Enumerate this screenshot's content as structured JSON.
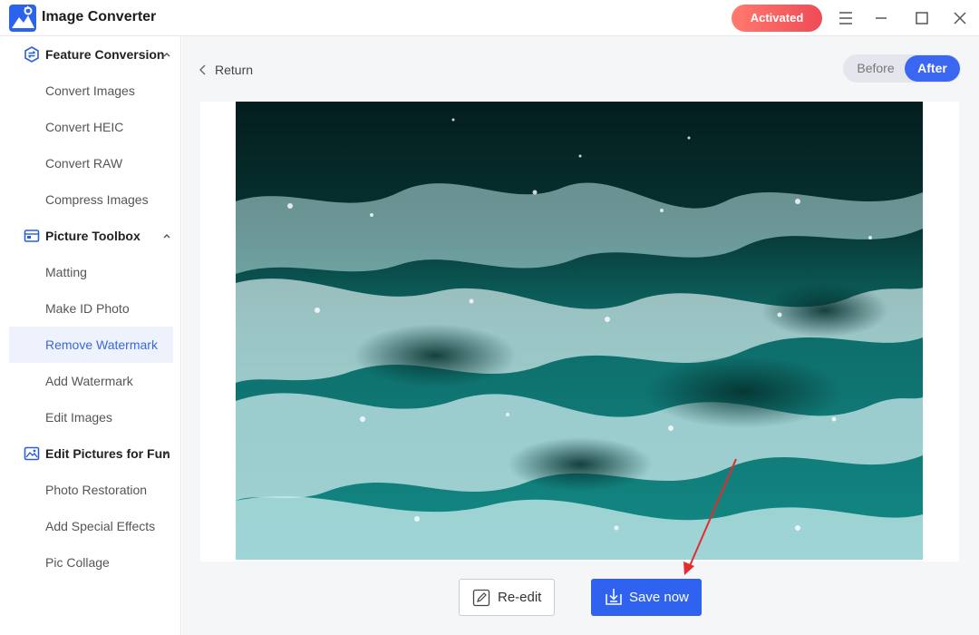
{
  "app": {
    "title": "Image Converter",
    "status_button": "Activated",
    "accent_color": "#2f62ee",
    "status_color": "#ef4b57"
  },
  "window_controls": {
    "menu_icon": "hamburger-menu-icon",
    "minimize_icon": "minimize-icon",
    "maximize_icon": "maximize-icon",
    "close_icon": "close-icon"
  },
  "sidebar": {
    "groups": [
      {
        "label": "Feature Conversion",
        "icon": "convert-icon",
        "items": [
          "Convert Images",
          "Convert HEIC",
          "Convert RAW",
          "Compress Images"
        ]
      },
      {
        "label": "Picture Toolbox",
        "icon": "toolbox-icon",
        "items": [
          "Matting",
          "Make ID Photo",
          "Remove Watermark",
          "Add Watermark",
          "Edit Images"
        ]
      },
      {
        "label": "Edit Pictures for Fun",
        "icon": "picture-icon",
        "items": [
          "Photo Restoration",
          "Add Special Effects",
          "Pic Collage"
        ]
      }
    ],
    "active_item": "Remove Watermark"
  },
  "main": {
    "return_label": "Return",
    "toggle": {
      "before": "Before",
      "after": "After",
      "selected": "After"
    },
    "image_description_icon": "ocean-waves-photo",
    "buttons": {
      "reedit": "Re-edit",
      "save": "Save now"
    }
  }
}
